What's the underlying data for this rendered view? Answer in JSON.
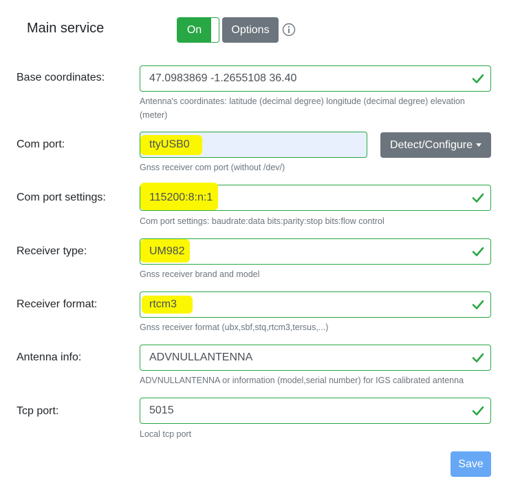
{
  "service": {
    "title": "Main service",
    "toggle_label": "On",
    "options_label": "Options",
    "info_icon": "info-circle-icon"
  },
  "fields": {
    "base_coordinates": {
      "label": "Base coordinates:",
      "value": "47.0983869 -1.2655108 36.40",
      "help": "Antenna's coordinates: latitude (decimal degree) longitude (decimal degree) elevation (meter)"
    },
    "com_port": {
      "label": "Com port:",
      "value": "ttyUSB0",
      "help": "Gnss receiver com port (without /dev/)",
      "detect_label": "Detect/Configure"
    },
    "com_port_settings": {
      "label": "Com port settings:",
      "value": "115200:8:n:1",
      "help": "Com port settings: baudrate:data bits:parity:stop bits:flow control"
    },
    "receiver_type": {
      "label": "Receiver type:",
      "value": "UM982",
      "help": "Gnss receiver brand and model"
    },
    "receiver_format": {
      "label": "Receiver format:",
      "value": "rtcm3",
      "help": "Gnss receiver format (ubx,sbf,stq,rtcm3,tersus,...)"
    },
    "antenna_info": {
      "label": "Antenna info:",
      "value": "ADVNULLANTENNA",
      "help": "ADVNULLANTENNA or information (model,serial number) for IGS calibrated antenna"
    },
    "tcp_port": {
      "label": "Tcp port:",
      "value": "5015",
      "help": "Local tcp port"
    }
  },
  "save_label": "Save",
  "colors": {
    "valid": "#28a745",
    "secondary": "#6c757d",
    "primary_light": "#66a8f5",
    "highlight": "#fbf700"
  }
}
